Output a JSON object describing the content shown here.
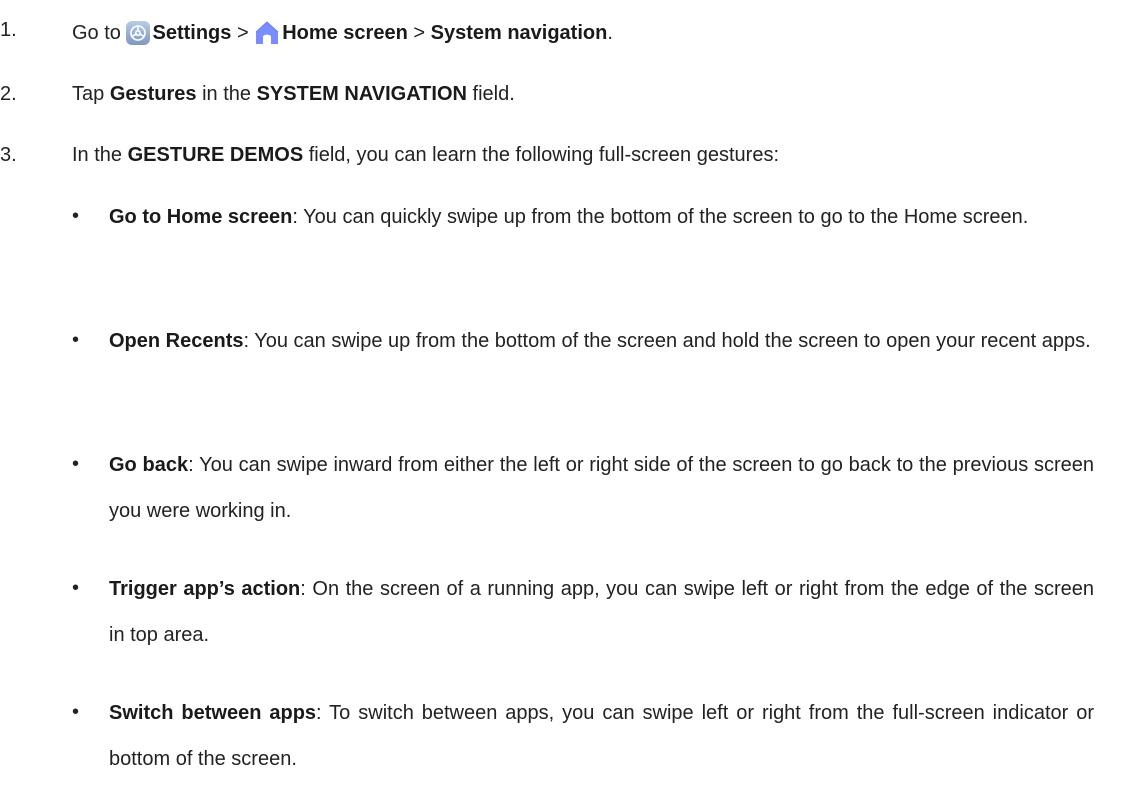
{
  "steps": [
    {
      "num": "1.",
      "pre": "Go to ",
      "settings": "Settings",
      "sep1": " > ",
      "home": "Home screen",
      "sep2": " > ",
      "sysnav": "System navigation",
      "end": ".",
      "icons": [
        "settings-gear-icon",
        "home-icon"
      ]
    },
    {
      "num": "2.",
      "pre": "Tap ",
      "b1": "Gestures",
      "mid": " in the ",
      "b2": "SYSTEM NAVIGATION",
      "end": " field."
    },
    {
      "num": "3.",
      "pre": "In the ",
      "b1": "GESTURE DEMOS",
      "end": " field, you can learn the following full-screen gestures:"
    }
  ],
  "bullets": [
    {
      "title": "Go to Home screen",
      "text": ": You can quickly swipe up from the bottom of the screen to go to the Home screen."
    },
    {
      "title": "Open Recents",
      "text": ": You can swipe up from the bottom of the screen and hold the screen to open your recent apps."
    },
    {
      "title": "Go back",
      "text": ": You can swipe inward from either the left or right side of the screen to go back to the previous screen you were working in."
    },
    {
      "title": "Trigger app’s action",
      "text": ": On the screen of a running app, you can swipe left or right from the edge of the screen in top area."
    },
    {
      "title": "Switch between apps",
      "text": ": To switch between apps, you can swipe left or right from the full-screen indicator or bottom of the screen."
    }
  ],
  "bullet_char": "•",
  "colors": {
    "home_icon": "#7a8cff",
    "settings_icon": "#8fa6c9"
  }
}
